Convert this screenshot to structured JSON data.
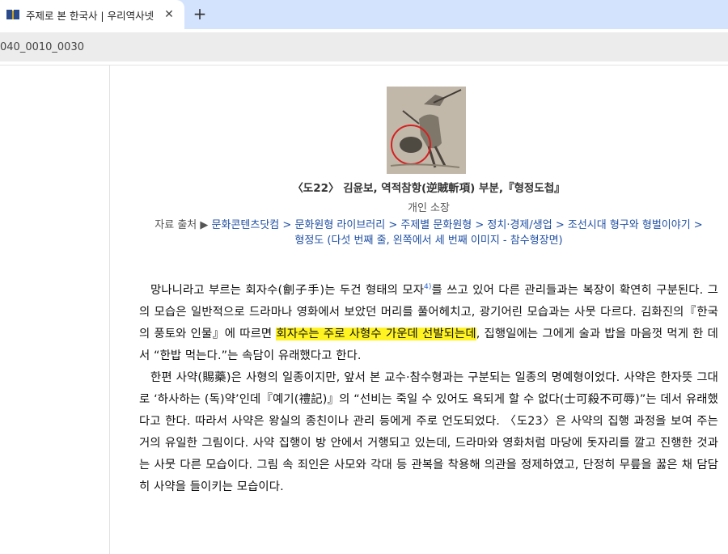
{
  "browser": {
    "tab_title": "주제로 본 한국사 | 우리역사넷",
    "tab_close": "✕",
    "new_tab": "+",
    "url": "040_0010_0030"
  },
  "figure": {
    "title": "〈도22〉 김윤보, 역적참항(逆賊斬項) 부분,『형정도첩』",
    "owner": "개인 소장"
  },
  "source": {
    "label": "자료 출처 ▶",
    "links": [
      "문화콘텐츠닷컴",
      "문화원형 라이브러리",
      "주제별 문화원형",
      "정치·경제/생업",
      "조선시대 형구와 형벌이야기",
      "형정도 (다섯 번째 줄, 왼쪽에서 세 번째 이미지 - 참수형장면)"
    ],
    "separator": " > "
  },
  "content": {
    "p1_a": "망나니라고 부르는 회자수(劊子手)는 두건 형태의 모자",
    "p1_fn": "4)",
    "p1_b": "를 쓰고 있어 다른 관리들과는 복장이 확연히 구분된다. 그의 모습은 일반적으로 드라마나 영화에서 보았던 머리를 풀어헤치고, 광기어린 모습과는 사뭇 다르다. 김화진의『한국의 풍토와 인물』에 따르면 ",
    "p1_hl": "회자수는 주로 사형수 가운데 선발되는데",
    "p1_c": ", 집행일에는 그에게 술과 밥을 마음껏 먹게 한 데서 “한밥 먹는다.”는 속담이 유래했다고 한다.",
    "p2": "한편 사약(賜藥)은 사형의 일종이지만, 앞서 본 교수·참수형과는 구분되는 일종의 명예형이었다. 사약은 한자뜻 그대로 ‘하사하는 (독)약’인데『예기(禮記)』의 “선비는 죽일 수 있어도 욕되게 할 수 없다(士可殺不可辱)”는 데서 유래했다고 한다. 따라서 사약은 왕실의 종친이나 관리 등에게 주로 언도되었다. 〈도23〉은 사약의 집행 과정을 보여 주는 거의 유일한 그림이다. 사약 집행이 방 안에서 거행되고 있는데, 드라마와 영화처럼 마당에 돗자리를 깔고 진행한 것과는 사뭇 다른 모습이다. 그림 속 죄인은 사모와 각대 등 관복을 착용해 의관을 정제하였고, 단정히 무릎을 꿇은 채 담담히 사약을 들이키는 모습이다."
  },
  "colors": {
    "highlight": "#fff321",
    "link": "#1f4fa3",
    "tabbar": "#d3e3fd"
  }
}
